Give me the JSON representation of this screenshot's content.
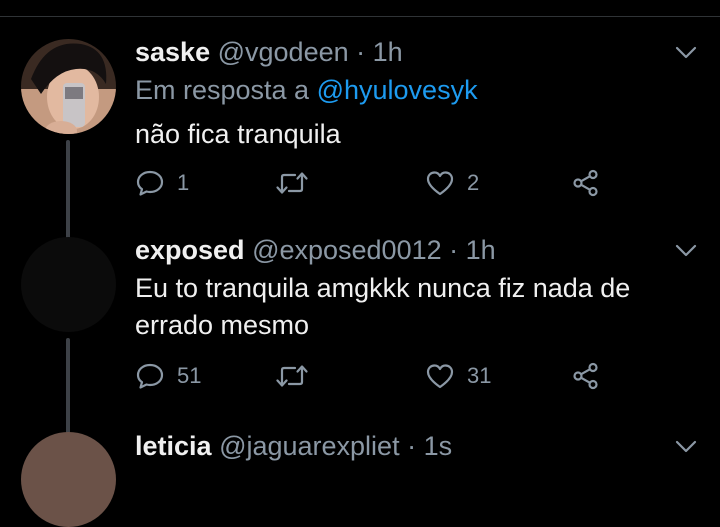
{
  "tweets": [
    {
      "name": "saske",
      "handle": "@vgodeen",
      "time": "· 1h",
      "reply_prefix": "Em resposta a",
      "reply_to": "@hyulovesyk",
      "text": "não fica tranquila",
      "replies": "1",
      "retweets": "",
      "likes": "2"
    },
    {
      "name": "exposed",
      "handle": "@exposed0012",
      "time": "· 1h",
      "text": "Eu to tranquila amgkkk nunca fiz nada de errado mesmo",
      "replies": "51",
      "retweets": "",
      "likes": "31"
    },
    {
      "name": "leticia",
      "handle": "@jaguarexpliet",
      "time": "· 1s"
    }
  ],
  "colors": {
    "background": "#000000",
    "primary_text": "#f0f0f0",
    "secondary_text": "#8b98a5",
    "link": "#1d9bf0",
    "thread_line": "#3d4147"
  },
  "icons": [
    "chevron-down-icon",
    "reply-icon",
    "retweet-icon",
    "like-icon",
    "share-icon"
  ]
}
